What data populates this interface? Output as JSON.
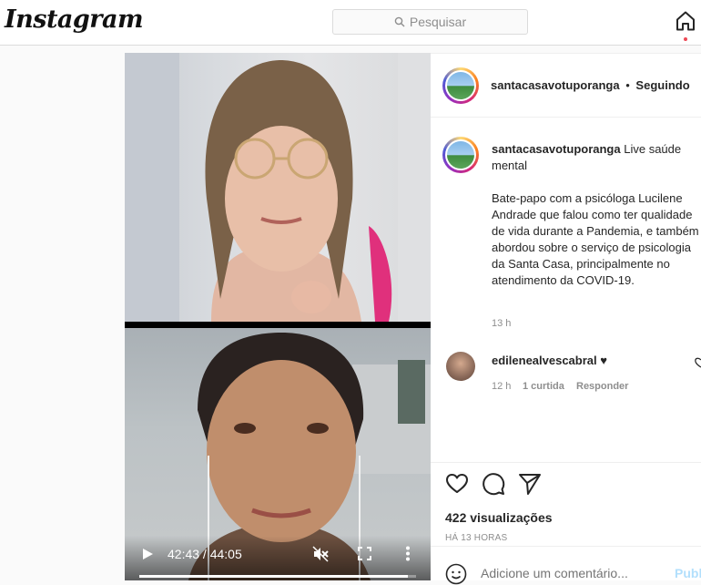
{
  "header": {
    "logo_text": "Instagram",
    "search_placeholder": "Pesquisar"
  },
  "video": {
    "current_time": "42:43",
    "separator": " / ",
    "duration": "44:05",
    "progress_fraction": 0.969
  },
  "post": {
    "author": "santacasavotuporanga",
    "follow_separator": "•",
    "follow_status": "Seguindo",
    "caption_title": "Live saúde mental",
    "caption_body": "Bate-papo com a psicóloga Lucilene Andrade que falou como ter qualidade de vida durante a Pandemia, e também abordou sobre o serviço de psicologia da Santa Casa, principalmente no atendimento da COVID-19.",
    "caption_time": "13 h",
    "comment": {
      "author": "edilenealvescabral",
      "text": "♥",
      "time": "12 h",
      "likes": "1 curtida",
      "reply": "Responder"
    },
    "views": "422 visualizações",
    "posted": "HÁ 13 HORAS",
    "comment_placeholder": "Adicione um comentário...",
    "publish": "Publ"
  },
  "colors": {
    "accent": "#0095f6",
    "notification": "#ed4956",
    "border": "#dbdbdb"
  },
  "icons": [
    "search-icon",
    "home-icon",
    "play-icon",
    "mute-icon",
    "fullscreen-icon",
    "more-icon",
    "heart-icon",
    "comment-icon",
    "share-icon",
    "emoji-icon"
  ]
}
